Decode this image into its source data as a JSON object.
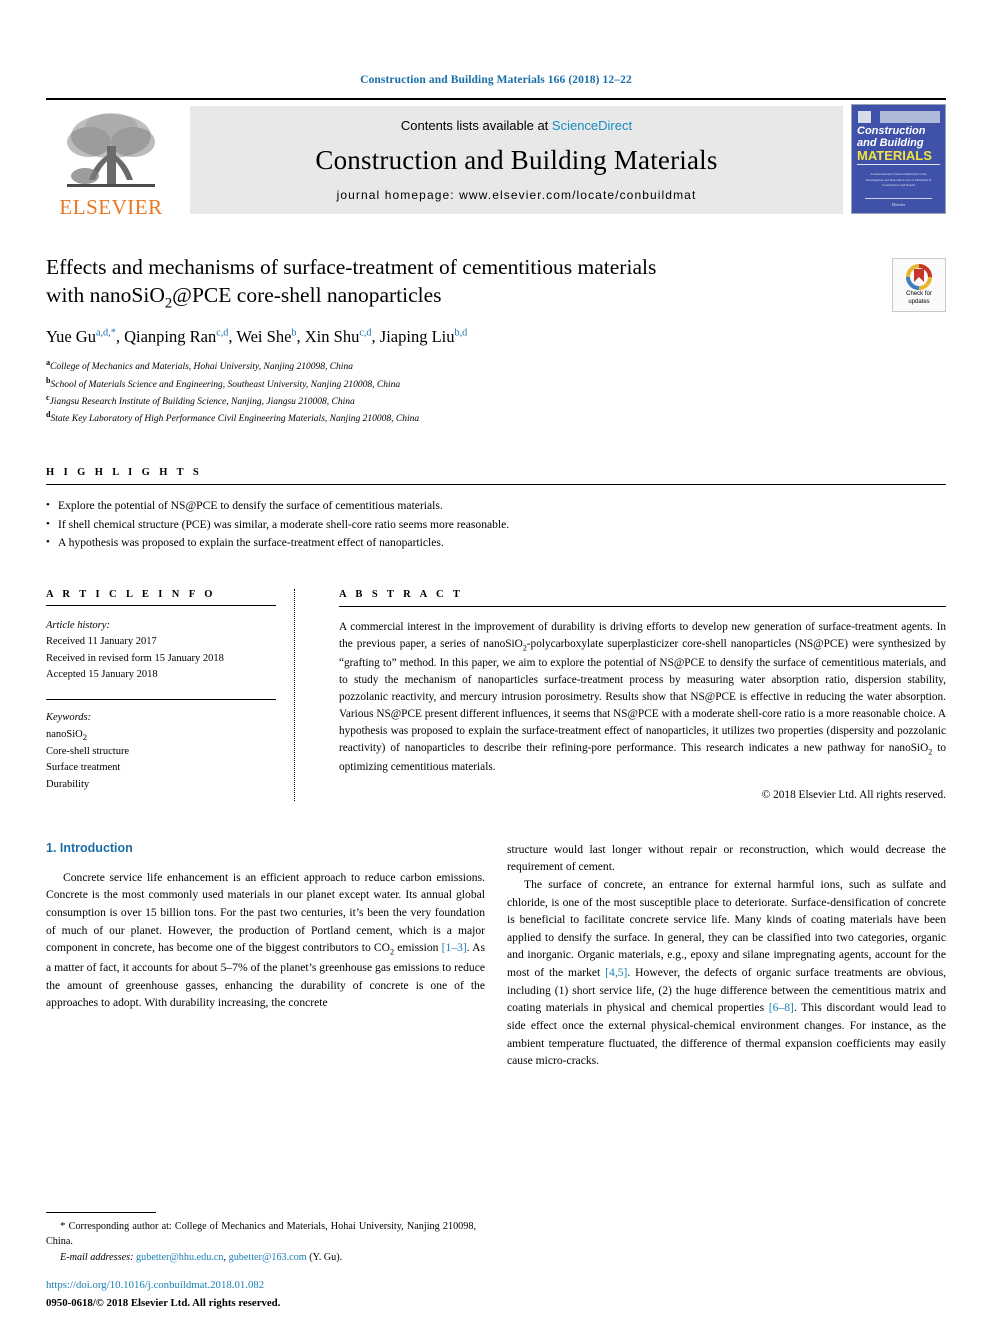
{
  "running_head": "Construction and Building Materials 166 (2018) 12–22",
  "masthead": {
    "publisher_name": "ELSEVIER",
    "contents_prefix": "Contents lists available at ",
    "contents_link": "ScienceDirect",
    "journal_name": "Construction and Building Materials",
    "homepage": "journal homepage: www.elsevier.com/locate/conbuildmat",
    "cover": {
      "line1": "Construction",
      "line2": "and Building",
      "line3": "MATERIALS",
      "blurb": "An International Journal Dedicated to the Investigation and Innovative Use of Materials in Construction and Repair",
      "foot": "Elsevier"
    }
  },
  "article": {
    "title_line1": "Effects and mechanisms of surface-treatment of cementitious materials",
    "title_line2_pre": "with nanoSiO",
    "title_line2_sub": "2",
    "title_line2_post": "@PCE core-shell nanoparticles",
    "crossmark_line1": "Check for",
    "crossmark_line2": "updates",
    "authors": [
      {
        "name": "Yue Gu",
        "sup": "a,d,*",
        "sep": ", "
      },
      {
        "name": "Qianping Ran",
        "sup": "c,d",
        "sep": ", "
      },
      {
        "name": "Wei She",
        "sup": "b",
        "sep": ", "
      },
      {
        "name": "Xin Shu",
        "sup": "c,d",
        "sep": ", "
      },
      {
        "name": "Jiaping Liu",
        "sup": "b,d",
        "sep": ""
      }
    ],
    "affiliations": [
      {
        "sup": "a",
        "text": "College of Mechanics and Materials, Hohai University, Nanjing 210098, China"
      },
      {
        "sup": "b",
        "text": "School of Materials Science and Engineering, Southeast University, Nanjing 210008, China"
      },
      {
        "sup": "c",
        "text": "Jiangsu Research Institute of Building Science, Nanjing, Jiangsu 210008, China"
      },
      {
        "sup": "d",
        "text": "State Key Laboratory of High Performance Civil Engineering Materials, Nanjing 210008, China"
      }
    ]
  },
  "highlights": {
    "heading": "H I G H L I G H T S",
    "items": [
      "Explore the potential of NS@PCE to densify the surface of cementitious materials.",
      "If shell chemical structure (PCE) was similar, a moderate shell-core ratio seems more reasonable.",
      "A hypothesis was proposed to explain the surface-treatment effect of nanoparticles."
    ]
  },
  "article_info": {
    "heading": "A R T I C L E   I N F O",
    "history_label": "Article history:",
    "history": [
      "Received 11 January 2017",
      "Received in revised form 15 January 2018",
      "Accepted 15 January 2018"
    ],
    "keywords_label": "Keywords:",
    "keywords_first_pre": "nanoSiO",
    "keywords_first_sub": "2",
    "keywords": [
      "Core-shell structure",
      "Surface treatment",
      "Durability"
    ]
  },
  "abstract": {
    "heading": "A B S T R A C T",
    "body_1": "A commercial interest in the improvement of durability is driving efforts to develop new generation of surface-treatment agents. In the previous paper, a series of nanoSiO",
    "sub_1": "2",
    "body_2": "-polycarboxylate superplasticizer core-shell nanoparticles (NS@PCE) were synthesized by “grafting to” method. In this paper, we aim to explore the potential of NS@PCE to densify the surface of cementitious materials, and to study the mechanism of nanoparticles surface-treatment process by measuring water absorption ratio, dispersion stability, pozzolanic reactivity, and mercury intrusion porosimetry. Results show that NS@PCE is effective in reducing the water absorption. Various NS@PCE present different influences, it seems that NS@PCE with a moderate shell-core ratio is a more reasonable choice. A hypothesis was proposed to explain the surface-treatment effect of nanoparticles, it utilizes two properties (dispersity and pozzolanic reactivity) of nanoparticles to describe their refining-pore performance. This research indicates a new pathway for nanoSiO",
    "sub_2": "2",
    "body_3": " to optimizing cementitious materials.",
    "copyright": "© 2018 Elsevier Ltd. All rights reserved."
  },
  "introduction": {
    "section_title": "1. Introduction",
    "left_p1_a": "Concrete service life enhancement is an efficient approach to reduce carbon emissions. Concrete is the most commonly used materials in our planet except water. Its annual global consumption is over 15 billion tons. For the past two centuries, it’s been the very foundation of much of our planet. However, the production of Portland cement, which is a major component in concrete, has become one of the biggest contributors to CO",
    "left_p1_sub": "2",
    "left_p1_b": " emission ",
    "left_p1_ref": "[1–3]",
    "left_p1_c": ". As a matter of fact, it accounts for about 5–7% of the planet’s greenhouse gas emissions to reduce the amount of greenhouse gasses, enhancing the durability of concrete is one of the approaches to adopt. With durability increasing, the concrete",
    "right_p1": "structure would last longer without repair or reconstruction, which would decrease the requirement of cement.",
    "right_p2_a": "The surface of concrete, an entrance for external harmful ions, such as sulfate and chloride, is one of the most susceptible place to deteriorate. Surface-densification of concrete is beneficial to facilitate concrete service life. Many kinds of coating materials have been applied to densify the surface. In general, they can be classified into two categories, organic and inorganic. Organic materials, e.g., epoxy and silane impregnating agents, account for the most of the market ",
    "right_p2_ref1": "[4,5]",
    "right_p2_b": ". However, the defects of organic surface treatments are obvious, including (1) short service life, (2) the huge difference between the cementitious matrix and coating materials in physical and chemical properties ",
    "right_p2_ref2": "[6–8]",
    "right_p2_c": ". This discordant would lead to side effect once the external physical-chemical environment changes. For instance, as the ambient temperature fluctuated, the difference of thermal expansion coefficients may easily cause micro-cracks."
  },
  "footnotes": {
    "corresponding_star": "*",
    "corresponding": " Corresponding author at: College of Mechanics and Materials, Hohai University, Nanjing 210098, China.",
    "email_label": "E-mail addresses:",
    "email_1": "gubetter@hhu.edu.cn",
    "email_sep": ", ",
    "email_2": "gubetter@163.com",
    "email_suffix": " (Y. Gu).",
    "doi": "https://doi.org/10.1016/j.conbuildmat.2018.01.082",
    "issn": "0950-0618/© 2018 Elsevier Ltd. All rights reserved."
  },
  "colors": {
    "link_blue": "#1a7fb5",
    "heading_blue": "#1a6ea8",
    "elsevier_orange": "#E87722",
    "cover_blue": "#3f51a8",
    "cover_yellow": "#f2e43c",
    "band_gray": "#e8e8e8"
  }
}
